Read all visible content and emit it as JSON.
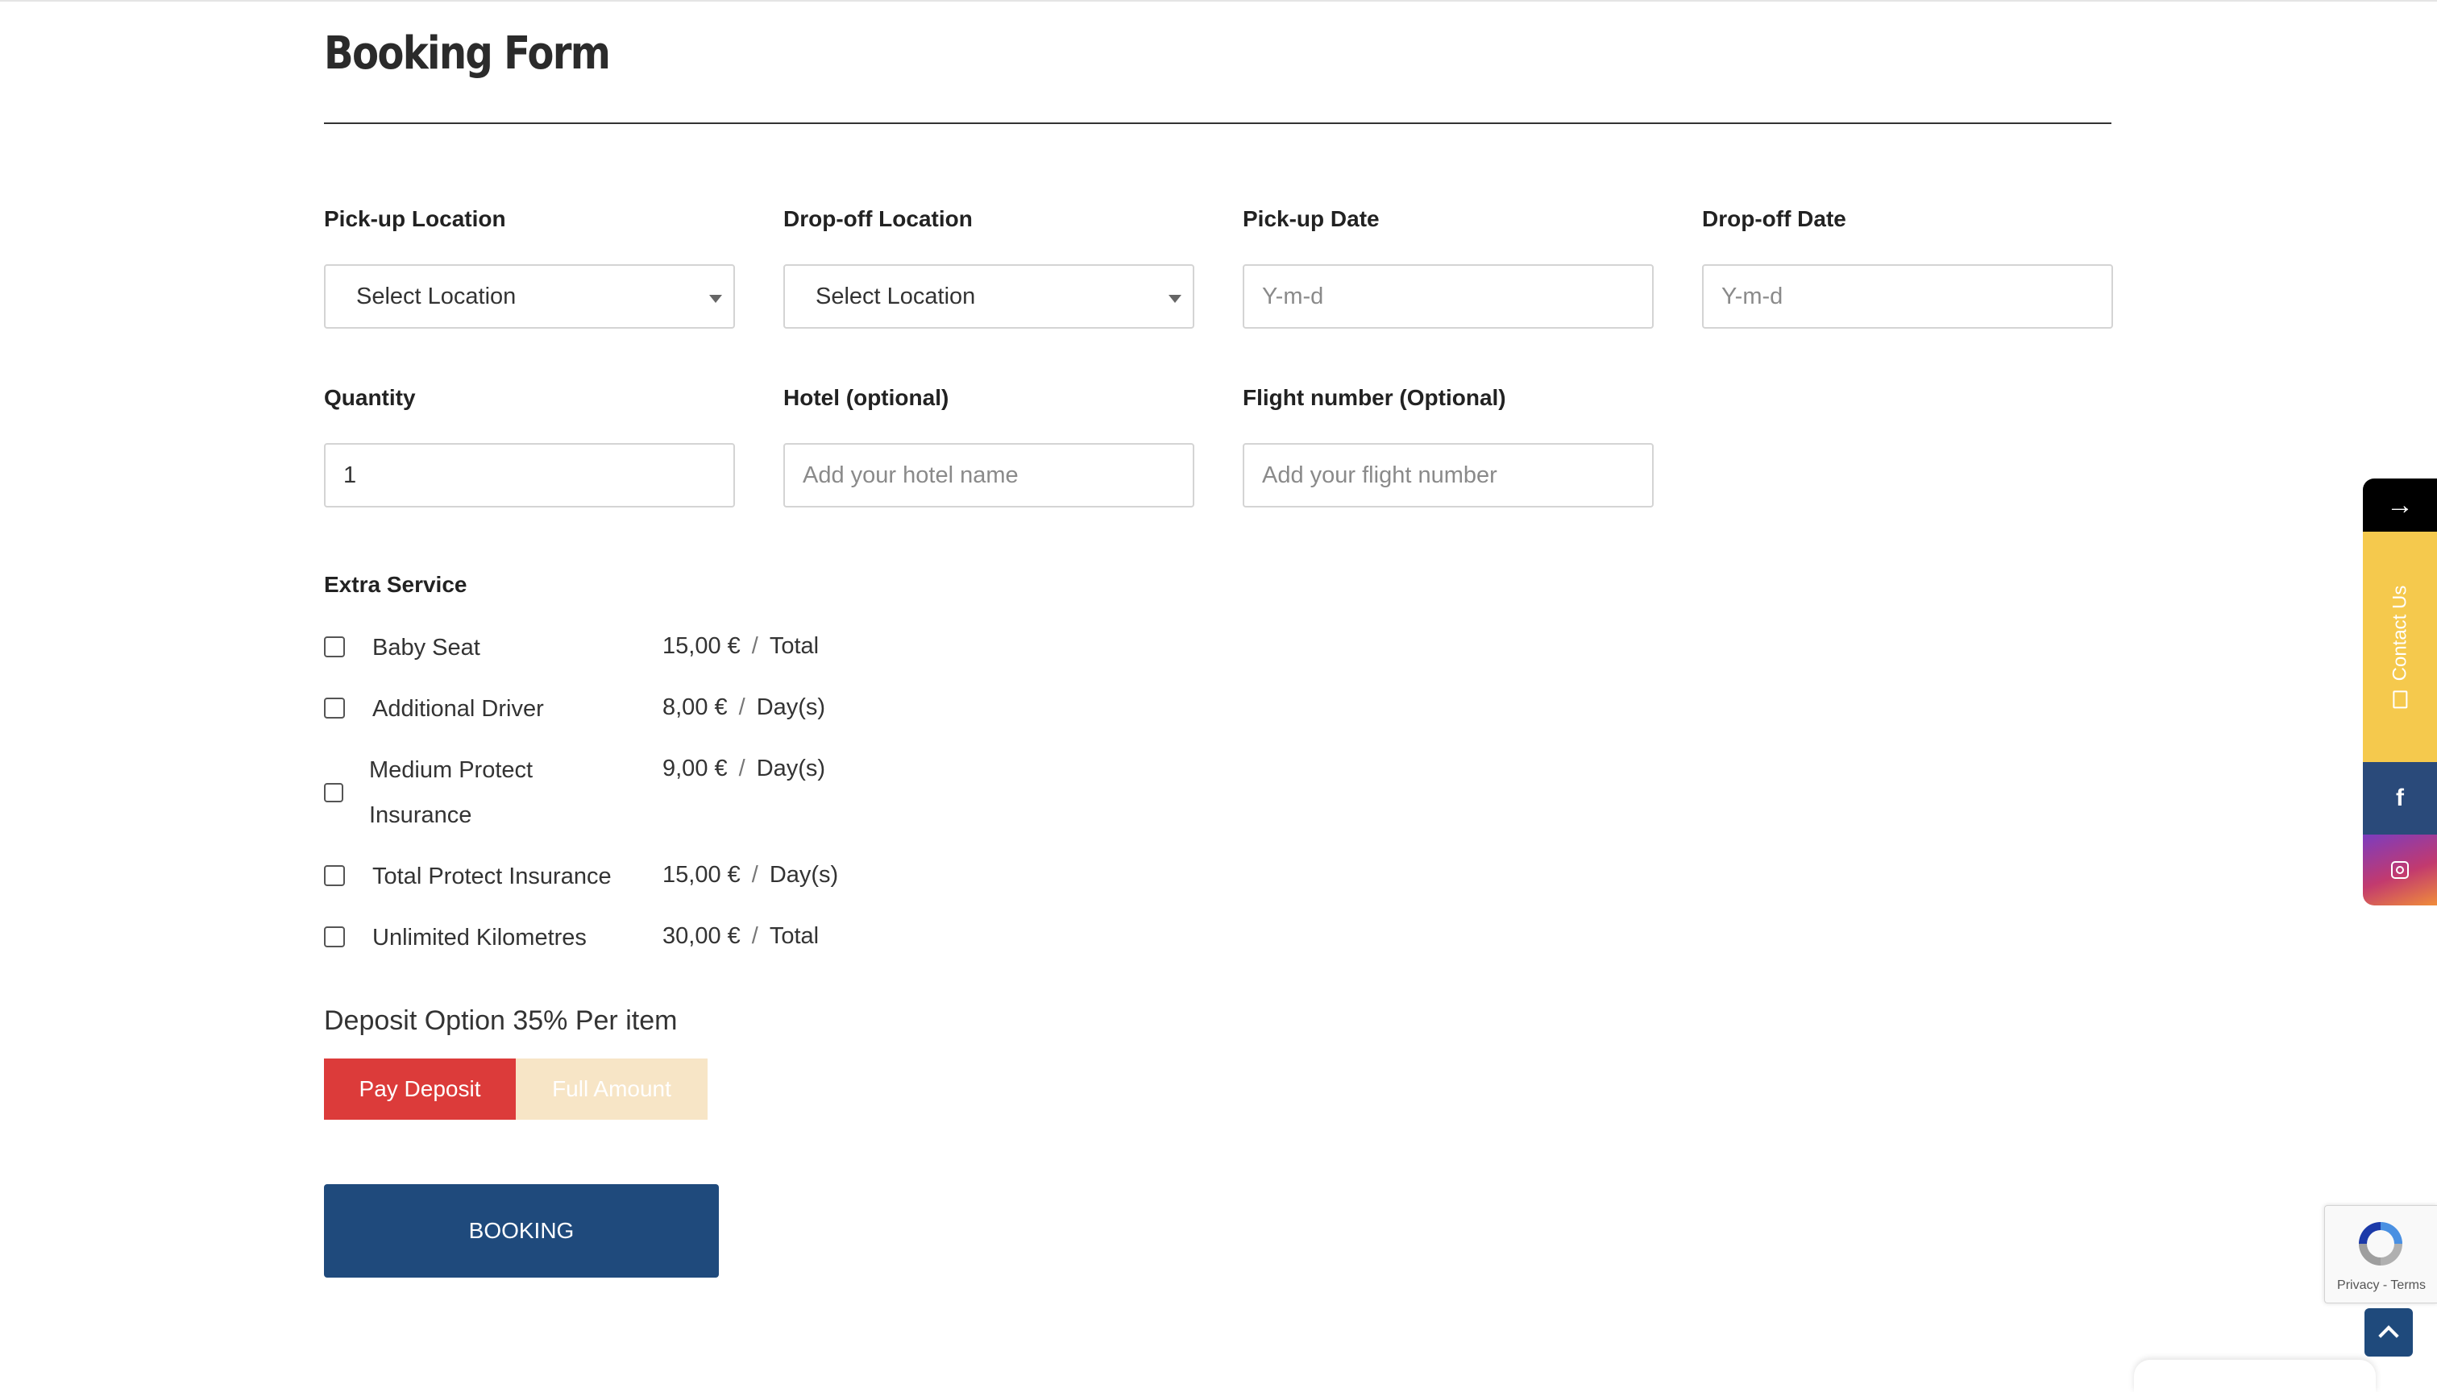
{
  "form": {
    "title": "Booking Form",
    "fields": {
      "pickup_location": {
        "label": "Pick-up Location",
        "value": "Select Location"
      },
      "dropoff_location": {
        "label": "Drop-off Location",
        "value": "Select Location"
      },
      "pickup_date": {
        "label": "Pick-up Date",
        "placeholder": "Y-m-d"
      },
      "dropoff_date": {
        "label": "Drop-off Date",
        "placeholder": "Y-m-d"
      },
      "quantity": {
        "label": "Quantity",
        "value": "1"
      },
      "hotel": {
        "label": "Hotel (optional)",
        "placeholder": "Add your hotel name"
      },
      "flight": {
        "label": "Flight number (Optional)",
        "placeholder": "Add your flight number"
      }
    },
    "extra_service": {
      "heading": "Extra Service",
      "items": [
        {
          "name": "Baby Seat",
          "price": "15,00 €",
          "unit": "Total",
          "checked": false
        },
        {
          "name": "Additional Driver",
          "price": "8,00 €",
          "unit": "Day(s)",
          "checked": false
        },
        {
          "name_line1": "Medium Protect",
          "name_line2": "Insurance",
          "price": "9,00 €",
          "unit": "Day(s)",
          "checked": false
        },
        {
          "name": "Total Protect Insurance",
          "price": "15,00 €",
          "unit": "Day(s)",
          "checked": false
        },
        {
          "name": "Unlimited Kilometres",
          "price": "30,00 €",
          "unit": "Total",
          "checked": false
        }
      ],
      "separator": "/"
    },
    "deposit": {
      "title": "Deposit Option 35% Per item",
      "pay_deposit_label": "Pay Deposit",
      "full_amount_label": "Full Amount",
      "selected": "Pay Deposit"
    },
    "submit_label": "BOOKING"
  },
  "side_widget": {
    "arrow": "→",
    "contact_label": "Contact Us",
    "facebook_icon": "facebook-icon",
    "instagram_icon": "instagram-icon"
  },
  "recaptcha": {
    "links": "Privacy - Terms"
  },
  "colors": {
    "deposit_active": "#dc3b3a",
    "deposit_inactive": "#f7e5c6",
    "booking_button": "#1f4a7c",
    "contact_yellow": "#f5c94d",
    "facebook_blue": "#2a4a7a"
  }
}
